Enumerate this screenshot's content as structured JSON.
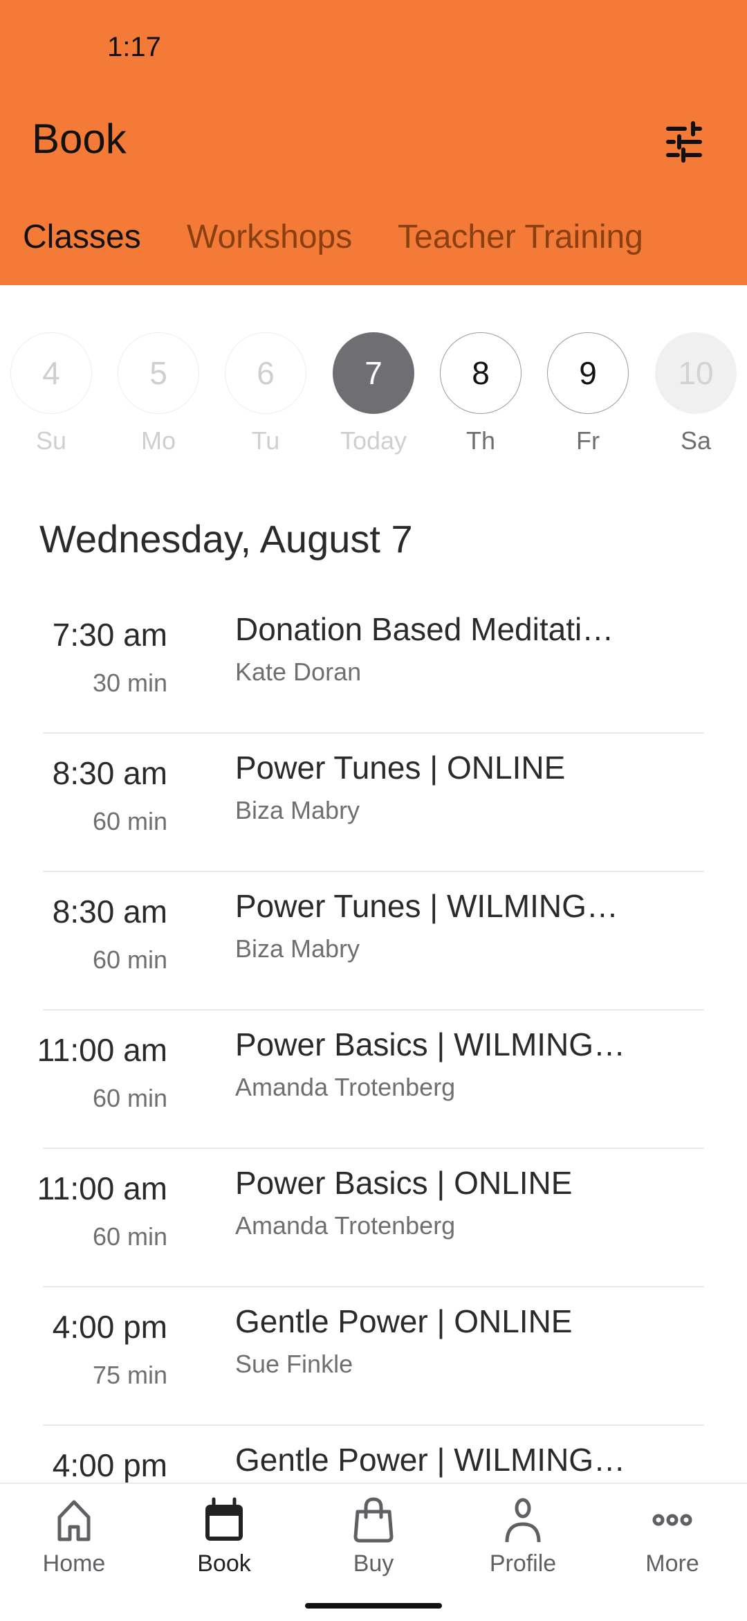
{
  "status_bar": {
    "time": "1:17"
  },
  "header": {
    "title": "Book",
    "filter_icon": "sliders-icon",
    "background_color": "#f47a38"
  },
  "tabs": [
    {
      "label": "Classes",
      "active": true
    },
    {
      "label": "Workshops",
      "active": false
    },
    {
      "label": "Teacher Training",
      "active": false
    }
  ],
  "date_strip": [
    {
      "number": "4",
      "label": "Su",
      "state": "past"
    },
    {
      "number": "5",
      "label": "Mo",
      "state": "past"
    },
    {
      "number": "6",
      "label": "Tu",
      "state": "past"
    },
    {
      "number": "7",
      "label": "Today",
      "state": "selected"
    },
    {
      "number": "8",
      "label": "Th",
      "state": "future"
    },
    {
      "number": "9",
      "label": "Fr",
      "state": "future"
    },
    {
      "number": "10",
      "label": "Sa",
      "state": "disabled"
    }
  ],
  "day_heading": "Wednesday, August 7",
  "classes": [
    {
      "time": "7:30 am",
      "duration": "30 min",
      "title": "Donation Based Meditati…",
      "teacher": "Kate Doran"
    },
    {
      "time": "8:30 am",
      "duration": "60 min",
      "title": "Power Tunes | ONLINE",
      "teacher": "Biza Mabry"
    },
    {
      "time": "8:30 am",
      "duration": "60 min",
      "title": "Power Tunes | WILMING…",
      "teacher": "Biza Mabry"
    },
    {
      "time": "11:00 am",
      "duration": "60 min",
      "title": "Power Basics | WILMING…",
      "teacher": "Amanda Trotenberg"
    },
    {
      "time": "11:00 am",
      "duration": "60 min",
      "title": "Power Basics | ONLINE",
      "teacher": "Amanda Trotenberg"
    },
    {
      "time": "4:00 pm",
      "duration": "75 min",
      "title": "Gentle Power | ONLINE",
      "teacher": "Sue Finkle"
    },
    {
      "time": "4:00 pm",
      "duration": "",
      "title": "Gentle Power | WILMING…",
      "teacher": ""
    }
  ],
  "bottom_nav": [
    {
      "label": "Home",
      "icon": "home-icon",
      "active": false
    },
    {
      "label": "Book",
      "icon": "calendar-icon",
      "active": true
    },
    {
      "label": "Buy",
      "icon": "shopping-bag-icon",
      "active": false
    },
    {
      "label": "Profile",
      "icon": "person-icon",
      "active": false
    },
    {
      "label": "More",
      "icon": "more-dots-icon",
      "active": false
    }
  ]
}
